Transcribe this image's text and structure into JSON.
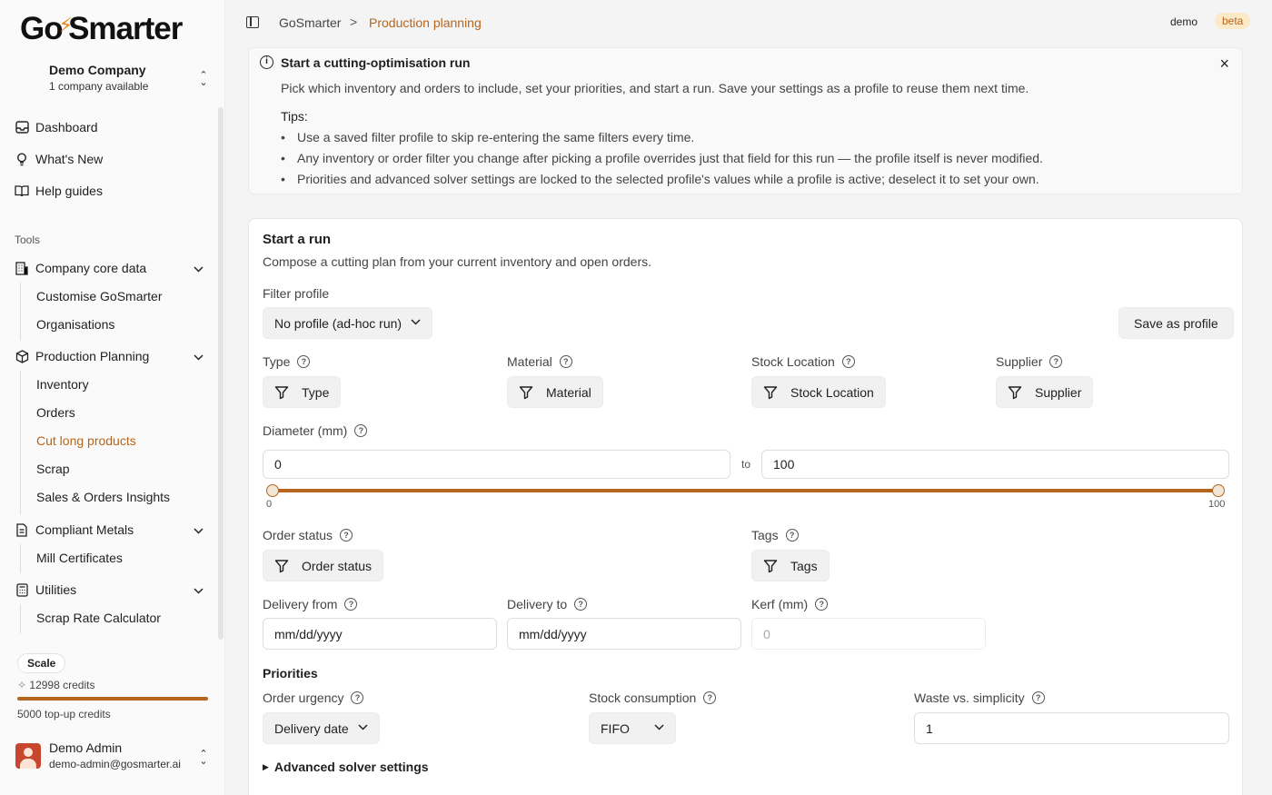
{
  "brand": {
    "logo_left": "Go",
    "logo_right": "Smarter"
  },
  "company": {
    "name": "Demo Company",
    "sub": "1 company available"
  },
  "nav": {
    "dashboard": "Dashboard",
    "whats_new": "What's New",
    "help_guides": "Help guides",
    "tools_label": "Tools",
    "core_data": "Company core data",
    "customise": "Customise GoSmarter",
    "organisations": "Organisations",
    "production_planning": "Production Planning",
    "inventory": "Inventory",
    "orders": "Orders",
    "cut_long": "Cut long products",
    "scrap": "Scrap",
    "sales_insights": "Sales & Orders Insights",
    "compliant_metals": "Compliant Metals",
    "mill_certs": "Mill Certificates",
    "utilities": "Utilities",
    "scrap_rate": "Scrap Rate Calculator"
  },
  "plan": {
    "name": "Scale",
    "credits": "12998 credits",
    "topup": "5000 top-up credits"
  },
  "user": {
    "name": "Demo Admin",
    "email": "demo-admin@gosmarter.ai"
  },
  "breadcrumb": {
    "root": "GoSmarter",
    "sep": ">",
    "current": "Production planning"
  },
  "env": {
    "name": "demo",
    "badge": "beta"
  },
  "info": {
    "title": "Start a cutting-optimisation run",
    "desc": "Pick which inventory and orders to include, set your priorities, and start a run. Save your settings as a profile to reuse them next time.",
    "tips_heading": "Tips:",
    "tips": [
      "Use a saved filter profile to skip re-entering the same filters every time.",
      "Any inventory or order filter you change after picking a profile overrides just that field for this run — the profile itself is never modified.",
      "Priorities and advanced solver settings are locked to the selected profile's values while a profile is active; deselect it to set your own."
    ],
    "close": "×"
  },
  "run": {
    "title": "Start a run",
    "subtitle": "Compose a cutting plan from your current inventory and open orders.",
    "filter_profile_label": "Filter profile",
    "filter_profile_value": "No profile (ad-hoc run)",
    "save_profile": "Save as profile",
    "type_label": "Type",
    "type_btn": "Type",
    "material_label": "Material",
    "material_btn": "Material",
    "stock_label": "Stock Location",
    "stock_btn": "Stock Location",
    "supplier_label": "Supplier",
    "supplier_btn": "Supplier",
    "diameter_label": "Diameter (mm)",
    "diameter_min": "0",
    "diameter_to": "to",
    "diameter_max": "100",
    "slider_min": "0",
    "slider_max": "100",
    "slider_range": [
      0,
      100
    ],
    "order_status_label": "Order status",
    "order_status_btn": "Order status",
    "tags_label": "Tags",
    "tags_btn": "Tags",
    "delivery_from_label": "Delivery from",
    "delivery_from_ph": "mm/dd/yyyy",
    "delivery_to_label": "Delivery to",
    "delivery_to_ph": "mm/dd/yyyy",
    "kerf_label": "Kerf (mm)",
    "kerf_value": "0",
    "priorities": "Priorities",
    "urgency_label": "Order urgency",
    "urgency_value": "Delivery date",
    "consumption_label": "Stock consumption",
    "consumption_value": "FIFO",
    "waste_label": "Waste vs. simplicity",
    "waste_value": "1",
    "advanced": "Advanced solver settings"
  },
  "colors": {
    "accent": "#b5651d",
    "beta_bg": "#fbe9c8"
  }
}
